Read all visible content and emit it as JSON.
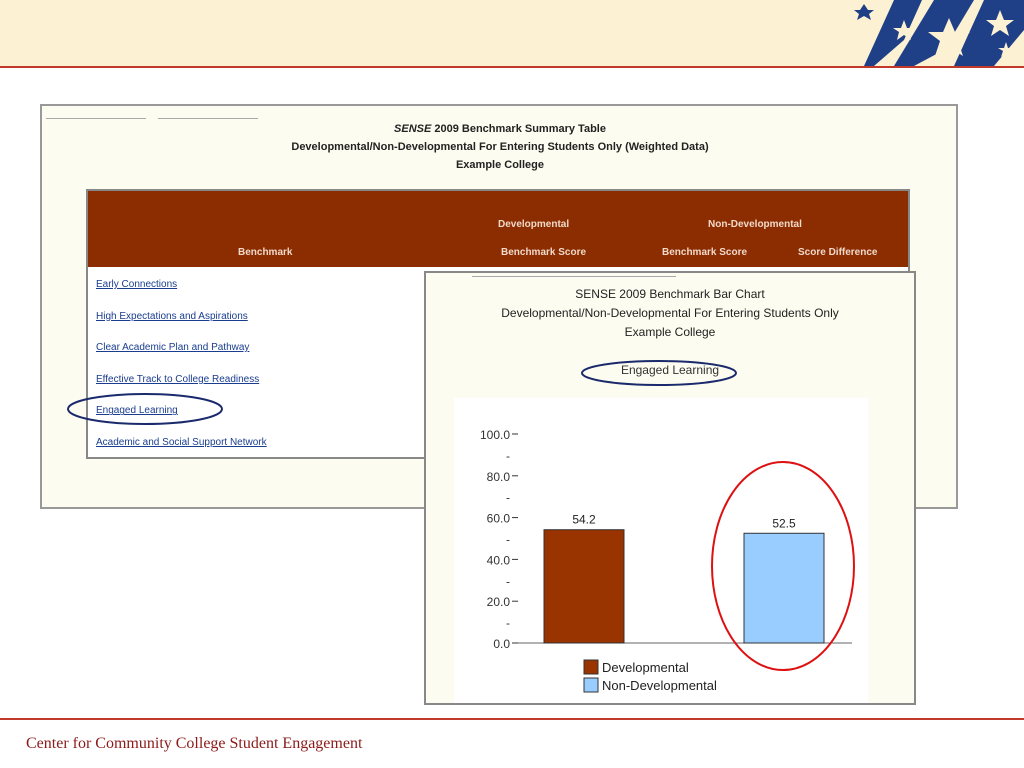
{
  "colors": {
    "accent_red": "#c0392b",
    "developmental": "#993300",
    "non_developmental": "#99ccff",
    "header_bg": "#8b2d00",
    "highlight_circle": "#1a2a6c",
    "red_circle": "#dd1111"
  },
  "footer": {
    "text": "Center for Community College Student Engagement"
  },
  "summary_table": {
    "title_italic": "SENSE",
    "title_rest": " 2009 Benchmark Summary Table",
    "subtitle": "Developmental/Non-Developmental For Entering Students Only (Weighted Data)",
    "college": "Example College",
    "headers": {
      "benchmark": "Benchmark",
      "developmental": "Developmental",
      "non_developmental": "Non-Developmental",
      "dev_score": "Benchmark Score",
      "nondev_score": "Benchmark Score",
      "score_difference": "Score Difference"
    },
    "benchmarks": [
      "Early Connections",
      "High Expectations and Aspirations",
      "Clear Academic Plan and Pathway",
      "Effective Track to College Readiness",
      "Engaged Learning",
      "Academic and Social Support Network"
    ]
  },
  "bar_chart": {
    "title": "SENSE 2009 Benchmark Bar Chart",
    "subtitle": "Developmental/Non-Developmental For Entering Students Only",
    "college": "Example College",
    "benchmark_label": "Engaged Learning"
  },
  "chart_data": {
    "type": "bar",
    "title": "Engaged Learning",
    "categories": [
      "Developmental",
      "Non-Developmental"
    ],
    "series": [
      {
        "name": "Developmental",
        "values": [
          54.2,
          null
        ]
      },
      {
        "name": "Non-Developmental",
        "values": [
          null,
          52.5
        ]
      }
    ],
    "values": [
      54.2,
      52.5
    ],
    "value_labels": [
      "54.2",
      "52.5"
    ],
    "ylim": [
      0,
      100
    ],
    "yticks": [
      "0.0",
      "20.0",
      "40.0",
      "60.0",
      "80.0",
      "100.0"
    ],
    "minor_tick_label": "-",
    "xlabel": "",
    "ylabel": "",
    "legend": [
      "Developmental",
      "Non-Developmental"
    ],
    "legend_position": "bottom-center",
    "grid": false
  }
}
